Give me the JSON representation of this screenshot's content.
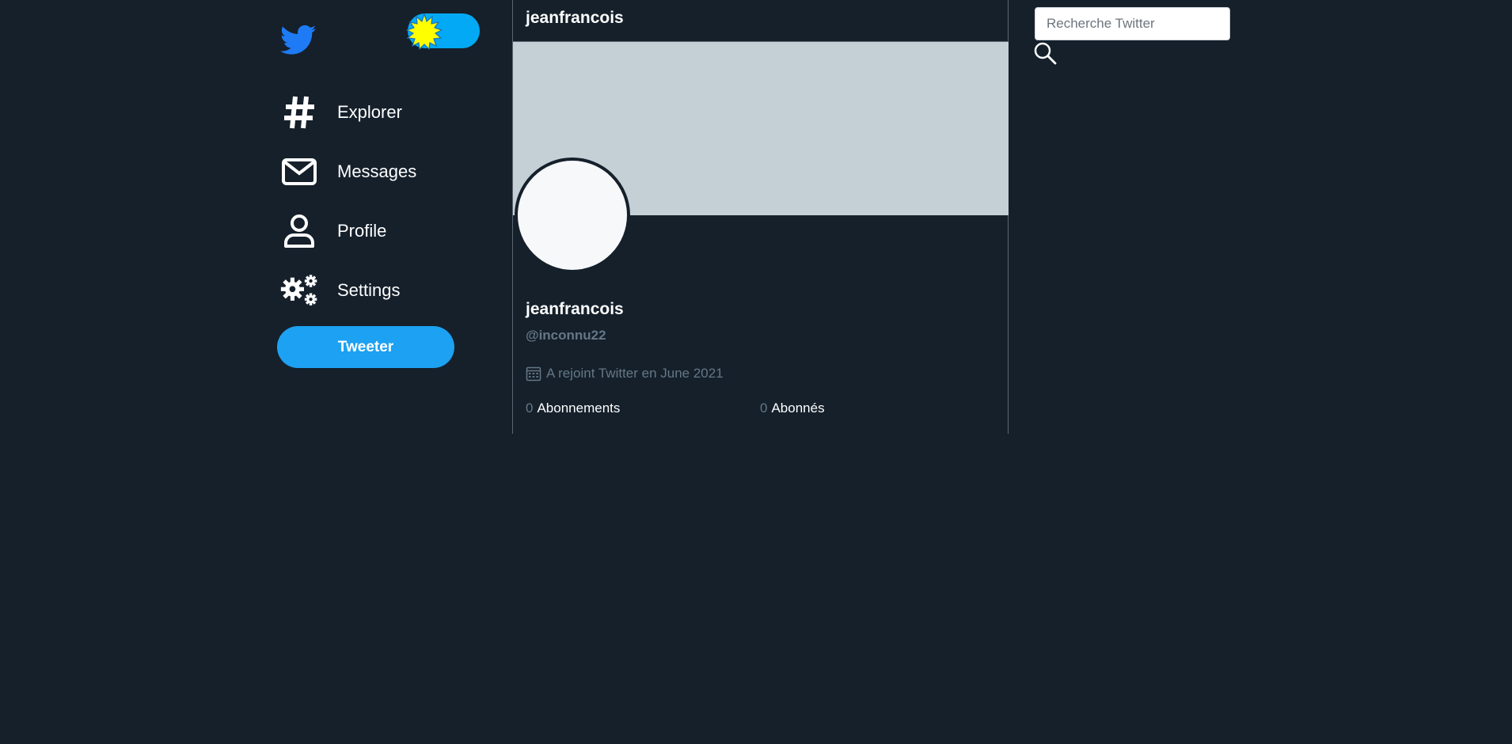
{
  "sidebar": {
    "logo_icon": "twitter-bird-icon",
    "theme_toggle_icon": "sun-icon",
    "items": [
      {
        "label": "Explorer",
        "icon": "hashtag-icon"
      },
      {
        "label": "Messages",
        "icon": "envelope-icon"
      },
      {
        "label": "Profile",
        "icon": "user-icon"
      },
      {
        "label": "Settings",
        "icon": "gears-icon"
      }
    ],
    "tweet_label": "Tweeter"
  },
  "profile": {
    "header_title": "jeanfrancois",
    "display_name": "jeanfrancois",
    "handle": "@inconnu22",
    "joined_text": "A rejoint Twitter en June 2021",
    "following_count": "0",
    "following_label": "Abonnements",
    "followers_count": "0",
    "followers_label": "Abonnés"
  },
  "search": {
    "placeholder": "Recherche Twitter",
    "icon": "search-icon"
  },
  "colors": {
    "background": "#15202b",
    "accent": "#1da1f2",
    "toggle": "#03a9f4",
    "banner": "#c4cfd6",
    "muted_text": "#657786",
    "bird": "#1e7bf5",
    "sun": "#ffff00"
  }
}
